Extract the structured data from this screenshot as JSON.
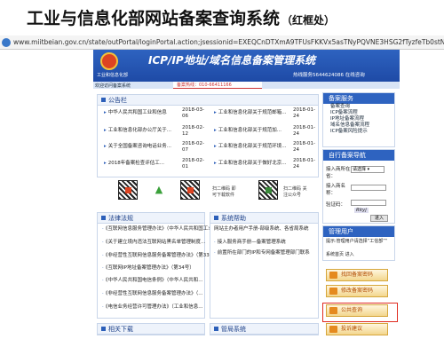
{
  "slide": {
    "title": "工业与信息化部网站备案查询系统",
    "subtitle": "（红框处）"
  },
  "browser": {
    "url": "www.miitbeian.gov.cn/state/outPortal/loginPortal.action;jsessionid=EXEQCnDTXmA9TFUsFKKVx5asTNyPQVNE3HSG2fTyzfeTb0stNZeQl-175182000"
  },
  "site": {
    "ministry_name": "工业和信息化部",
    "banner_title": "ICP/IP地址/域名信息备案管理系统",
    "hotline": "热线服务5644624086 在线咨询",
    "welcome": "欢迎访问备案系统",
    "hotline_small": "备案热线：010-66411166"
  },
  "notice": {
    "heading": "公告栏",
    "left": [
      {
        "text": "中华人民共和国工业和信息",
        "date": "2018-03-06"
      },
      {
        "text": "工业和信息化部办公厅关于...",
        "date": "2018-02-12"
      },
      {
        "text": "关于全国备案咨询电话业务...",
        "date": "2018-02-07"
      },
      {
        "text": "2018年备案检查评估工...",
        "date": "2018-02-01"
      }
    ],
    "right": [
      {
        "text": "工业和信息化部关于规范邮箱...",
        "date": "2018-01-24"
      },
      {
        "text": "工业和信息化部关于规范加...",
        "date": "2018-01-24"
      },
      {
        "text": "工业和信息化部关于规范环境...",
        "date": "2018-01-24"
      },
      {
        "text": "工业和信息化部关于做好北京...",
        "date": "2018-01-24"
      }
    ]
  },
  "apps": {
    "scan_left": "扫二维码 即可下载软件",
    "scan_right": "扫二维码 关注公众号"
  },
  "laws": {
    "heading": "法律法规",
    "items": [
      "《互联网信息服务管理办法》（中华人民共和国工业...",
      "《关于建立境内违法互联网站黑名单管理制度...",
      "《非经营性互联网信息服务备案管理办法》（第33号）",
      "《互联网IP地址备案管理办法》（第34号）",
      "《中华人民共和国电信条例》（中华人民共和...",
      "《非经营性互联网信息服务备案管理办法》（...",
      "《电信业务经营许可管理办法》（工业和信息..."
    ]
  },
  "help": {
    "heading": "系统帮助",
    "items": [
      "网站主办者用户手册-部级系统、各省局系统",
      "接入服务商手册—备案管理系统",
      "前置所在部门的IP和专网备案管理部门联系"
    ]
  },
  "bottom": {
    "downloads": "相关下载",
    "management": "管局系统"
  },
  "sidebar": {
    "service_heading": "备案服务",
    "service_items": [
      "备案查询",
      "ICP备案流程",
      "IP地址备案流程",
      "域名信息备案流程",
      "ICP备案风险提示"
    ],
    "user_heading": "自行备案导航",
    "province_label": "接入商所在省：",
    "province_placeholder": "请选择",
    "name_label": "接入商名称：",
    "captcha_label": "验证码：",
    "captcha_code": "Rkyj",
    "enter_button": "进入",
    "manage_heading": "管理用户",
    "manage_text": "提示:管理用户请选择“工信部”“",
    "manage_link": "系统首页 进入",
    "find_password": "找回备案密码",
    "change_password": "修改备案密码",
    "public_query": "公共查询",
    "complaint": "投诉建议"
  }
}
